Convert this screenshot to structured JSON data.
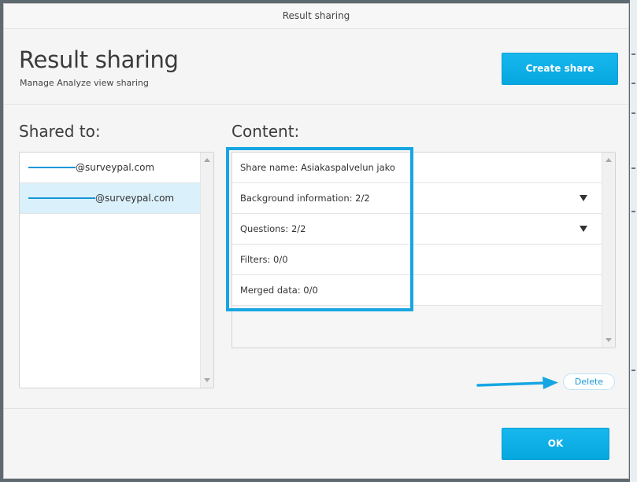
{
  "window": {
    "title": "Result sharing"
  },
  "header": {
    "title": "Result sharing",
    "subtitle": "Manage Analyze view sharing",
    "create_button": "Create share"
  },
  "shared": {
    "label": "Shared to:",
    "items": [
      {
        "email_suffix": "@surveypal.com",
        "selected": false
      },
      {
        "email_suffix": "@surveypal.com",
        "selected": true
      }
    ]
  },
  "content": {
    "label": "Content:",
    "rows": [
      {
        "text": "Share name: Asiakaspalvelun jako",
        "has_dropdown": false
      },
      {
        "text": "Background information: 2/2",
        "has_dropdown": true
      },
      {
        "text": "Questions: 2/2",
        "has_dropdown": true
      },
      {
        "text": "Filters: 0/0",
        "has_dropdown": false
      },
      {
        "text": "Merged data: 0/0",
        "has_dropdown": false
      }
    ]
  },
  "actions": {
    "delete_label": "Delete",
    "ok_label": "OK"
  },
  "colors": {
    "accent": "#0aaee6",
    "selection": "#daf0fa",
    "highlight_border": "#17a6e2"
  }
}
